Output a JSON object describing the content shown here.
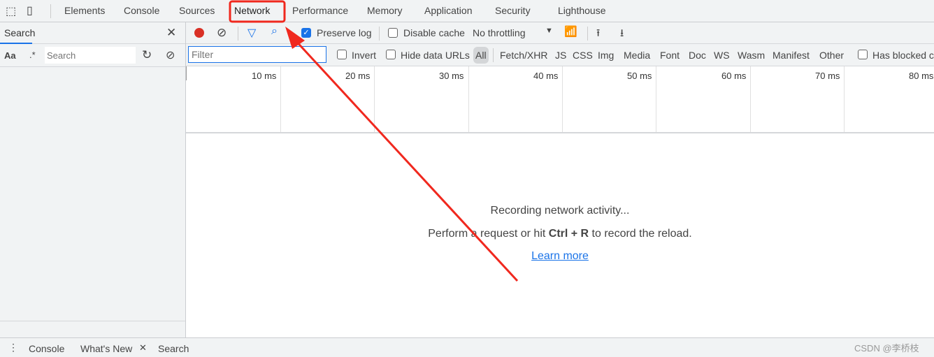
{
  "tabs": [
    "Elements",
    "Console",
    "Sources",
    "Network",
    "Performance",
    "Memory",
    "Application",
    "Security",
    "Lighthouse"
  ],
  "active_tab": "Network",
  "search_panel": {
    "title": "Search",
    "case_label": "Aa",
    "regex_label": ".*",
    "placeholder": "Search"
  },
  "toolbar": {
    "preserve_log": "Preserve log",
    "preserve_checked": true,
    "disable_cache": "Disable cache",
    "throttling": "No throttling"
  },
  "filter": {
    "placeholder": "Filter",
    "invert": "Invert",
    "hide_data_urls": "Hide data URLs",
    "types": [
      "All",
      "Fetch/XHR",
      "JS",
      "CSS",
      "Img",
      "Media",
      "Font",
      "Doc",
      "WS",
      "Wasm",
      "Manifest",
      "Other"
    ],
    "has_blocked": "Has blocked c"
  },
  "timeline": {
    "ticks": [
      "10 ms",
      "20 ms",
      "30 ms",
      "40 ms",
      "50 ms",
      "60 ms",
      "70 ms",
      "80 ms"
    ]
  },
  "empty": {
    "line1": "Recording network activity...",
    "line2_pre": "Perform a request or hit ",
    "shortcut": "Ctrl + R",
    "line2_post": " to record the reload.",
    "link": "Learn more"
  },
  "drawer": {
    "tabs": [
      "Console",
      "What's New",
      "Search"
    ]
  },
  "watermark": "CSDN @李桥枝",
  "colors": {
    "annotation": "#f0281e",
    "accent": "#1a73e8",
    "record": "#d93025"
  }
}
